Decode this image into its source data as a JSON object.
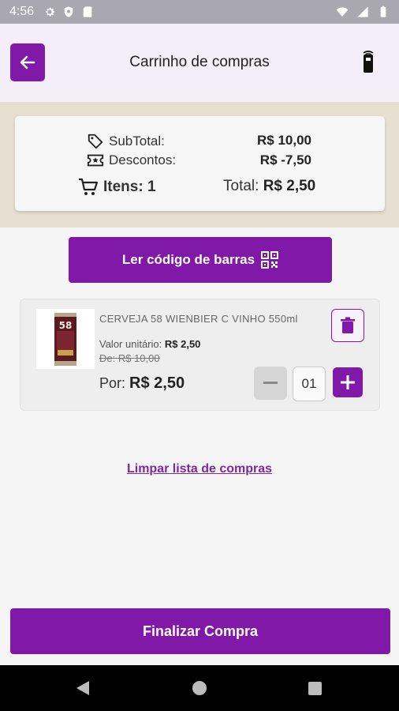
{
  "status_bar": {
    "time": "4:56"
  },
  "app_bar": {
    "title": "Carrinho de compras"
  },
  "summary": {
    "subtotal_label": "SubTotal:",
    "subtotal_value": "R$ 10,00",
    "discount_label": "Descontos:",
    "discount_value": "R$ -7,50",
    "items_label": "Itens: 1",
    "total_label": "Total:",
    "total_value": "R$ 2,50"
  },
  "scan_button": {
    "label": "Ler código de barras"
  },
  "cart_items": [
    {
      "name": "CERVEJA 58 WIENBIER C VINHO 550ml",
      "unit_label": "Valor unitário:",
      "unit_value": "R$ 2,50",
      "old_price": "De: R$ 10,00",
      "por_label": "Por:",
      "por_value": "R$ 2,50",
      "quantity": "01",
      "can_label": "58"
    }
  ],
  "clear_link": "Limpar lista de compras",
  "finish_button": "Finalizar Compra",
  "colors": {
    "primary": "#8019a8",
    "band": "#e7e0d2",
    "app_bar": "#f4eef8"
  }
}
